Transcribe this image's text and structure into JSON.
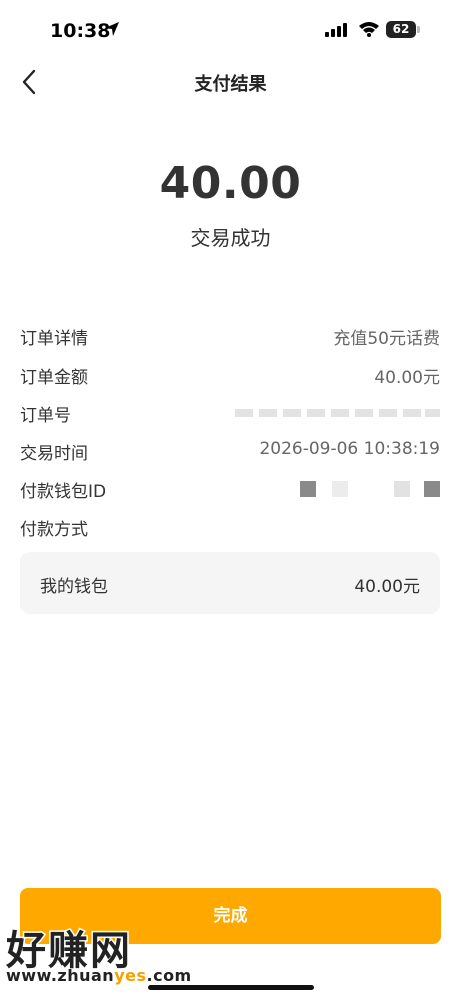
{
  "status_bar": {
    "time": "10:38",
    "battery": "62"
  },
  "nav": {
    "title": "支付结果"
  },
  "result": {
    "amount": "40.00",
    "status": "交易成功"
  },
  "details": [
    {
      "label": "订单详情",
      "value": "充值50元话费"
    },
    {
      "label": "订单金额",
      "value": "40.00元"
    },
    {
      "label": "订单号",
      "value": ""
    },
    {
      "label": "交易时间",
      "value": "2026-09-06 10:38:19"
    },
    {
      "label": "付款钱包ID",
      "value": ""
    },
    {
      "label": "付款方式",
      "value": ""
    }
  ],
  "payment": {
    "method": "我的钱包",
    "amount": "40.00元"
  },
  "done_button": "完成",
  "watermark": {
    "text": "好赚网",
    "url": "www.zhuanyes.com",
    "url_accent_color": "#f5a000"
  },
  "colors": {
    "accent": "#ffa900",
    "card_bg": "#f5f5f5"
  }
}
